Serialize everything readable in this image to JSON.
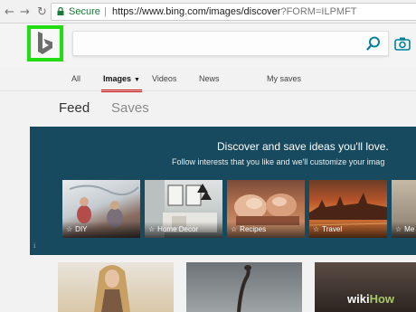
{
  "browser": {
    "back_icon": "arrow-left-icon",
    "forward_icon": "arrow-right-icon",
    "reload_icon": "reload-icon",
    "secure_label": "Secure",
    "url_main": "https://www.bing.com/images/discover",
    "url_query": "?FORM=ILPMFT"
  },
  "header": {
    "logo_letter": "b",
    "logo_highlight_color": "#22dd11",
    "search_placeholder": ""
  },
  "tabs": {
    "all": "All",
    "images": "Images",
    "videos": "Videos",
    "news": "News",
    "my_saves": "My saves",
    "active_color": "#c80000"
  },
  "subtabs": {
    "feed": "Feed",
    "saves": "Saves"
  },
  "banner": {
    "title": "Discover and save ideas you'll love.",
    "subtitle": "Follow interests that you like and we'll customize your imag",
    "info": "i",
    "background": "#174a5e",
    "cards": [
      {
        "label": "DIY"
      },
      {
        "label": "Home Decor"
      },
      {
        "label": "Recipes"
      },
      {
        "label": "Travel"
      },
      {
        "label": "Me"
      }
    ]
  },
  "watermark": {
    "part1": "wiki",
    "part2": "How"
  }
}
